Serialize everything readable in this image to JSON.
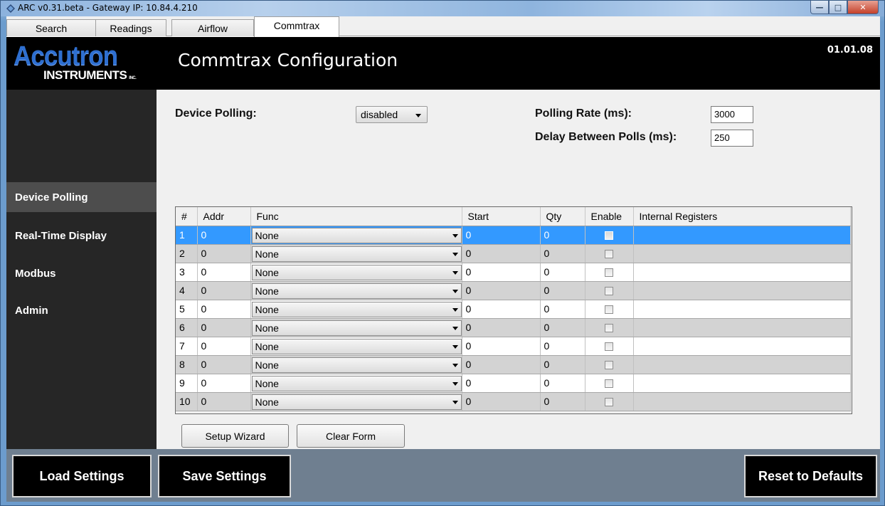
{
  "window": {
    "title": "ARC v0.31.beta - Gateway IP: 10.84.4.210"
  },
  "tabs": [
    {
      "label": "Search"
    },
    {
      "label": "Readings"
    },
    {
      "label": "Airflow"
    },
    {
      "label": "Commtrax",
      "active": true
    }
  ],
  "header": {
    "logo_main": "Accutron",
    "logo_sub": "INSTRUMENTS",
    "logo_suffix": "INC.",
    "title": "Commtrax Configuration",
    "version": "01.01.08"
  },
  "sidebar": {
    "items": [
      {
        "label": "Device Polling",
        "active": true
      },
      {
        "label": "Real-Time Display"
      },
      {
        "label": "Modbus"
      },
      {
        "label": "Admin"
      }
    ]
  },
  "form": {
    "device_polling_label": "Device Polling:",
    "device_polling_value": "disabled",
    "polling_rate_label": "Polling Rate (ms):",
    "polling_rate_value": "3000",
    "delay_label": "Delay Between Polls (ms):",
    "delay_value": "250"
  },
  "grid": {
    "columns": [
      "#",
      "Addr",
      "Func",
      "Start",
      "Qty",
      "Enable",
      "Internal Registers"
    ],
    "rows": [
      {
        "num": "1",
        "addr": "0",
        "func": "None",
        "start": "0",
        "qty": "0",
        "enable": false,
        "registers": ""
      },
      {
        "num": "2",
        "addr": "0",
        "func": "None",
        "start": "0",
        "qty": "0",
        "enable": false,
        "registers": ""
      },
      {
        "num": "3",
        "addr": "0",
        "func": "None",
        "start": "0",
        "qty": "0",
        "enable": false,
        "registers": ""
      },
      {
        "num": "4",
        "addr": "0",
        "func": "None",
        "start": "0",
        "qty": "0",
        "enable": false,
        "registers": ""
      },
      {
        "num": "5",
        "addr": "0",
        "func": "None",
        "start": "0",
        "qty": "0",
        "enable": false,
        "registers": ""
      },
      {
        "num": "6",
        "addr": "0",
        "func": "None",
        "start": "0",
        "qty": "0",
        "enable": false,
        "registers": ""
      },
      {
        "num": "7",
        "addr": "0",
        "func": "None",
        "start": "0",
        "qty": "0",
        "enable": false,
        "registers": ""
      },
      {
        "num": "8",
        "addr": "0",
        "func": "None",
        "start": "0",
        "qty": "0",
        "enable": false,
        "registers": ""
      },
      {
        "num": "9",
        "addr": "0",
        "func": "None",
        "start": "0",
        "qty": "0",
        "enable": false,
        "registers": ""
      },
      {
        "num": "10",
        "addr": "0",
        "func": "None",
        "start": "0",
        "qty": "0",
        "enable": false,
        "registers": ""
      }
    ],
    "selected_row": 0
  },
  "buttons": {
    "setup_wizard": "Setup Wizard",
    "clear_form": "Clear Form",
    "load_settings": "Load Settings",
    "save_settings": "Save Settings",
    "reset_defaults": "Reset to Defaults"
  },
  "colors": {
    "accent_selection": "#3399ff",
    "logo_blue": "#2e6fd0",
    "sidebar_bg": "#262626",
    "footer_bg": "#6f7f90"
  }
}
